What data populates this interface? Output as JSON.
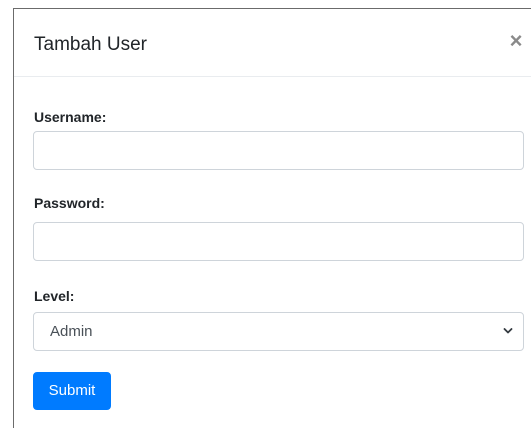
{
  "modal": {
    "title": "Tambah User",
    "close_glyph": "×"
  },
  "form": {
    "username": {
      "label": "Username:",
      "value": "",
      "placeholder": ""
    },
    "password": {
      "label": "Password:",
      "value": "",
      "placeholder": ""
    },
    "level": {
      "label": "Level:",
      "selected": "Admin"
    },
    "submit_label": "Submit"
  },
  "icons": {
    "close": "close-icon",
    "chevron": "chevron-down-icon"
  },
  "colors": {
    "primary": "#007bff",
    "border": "#ced4da",
    "text": "#212529"
  }
}
